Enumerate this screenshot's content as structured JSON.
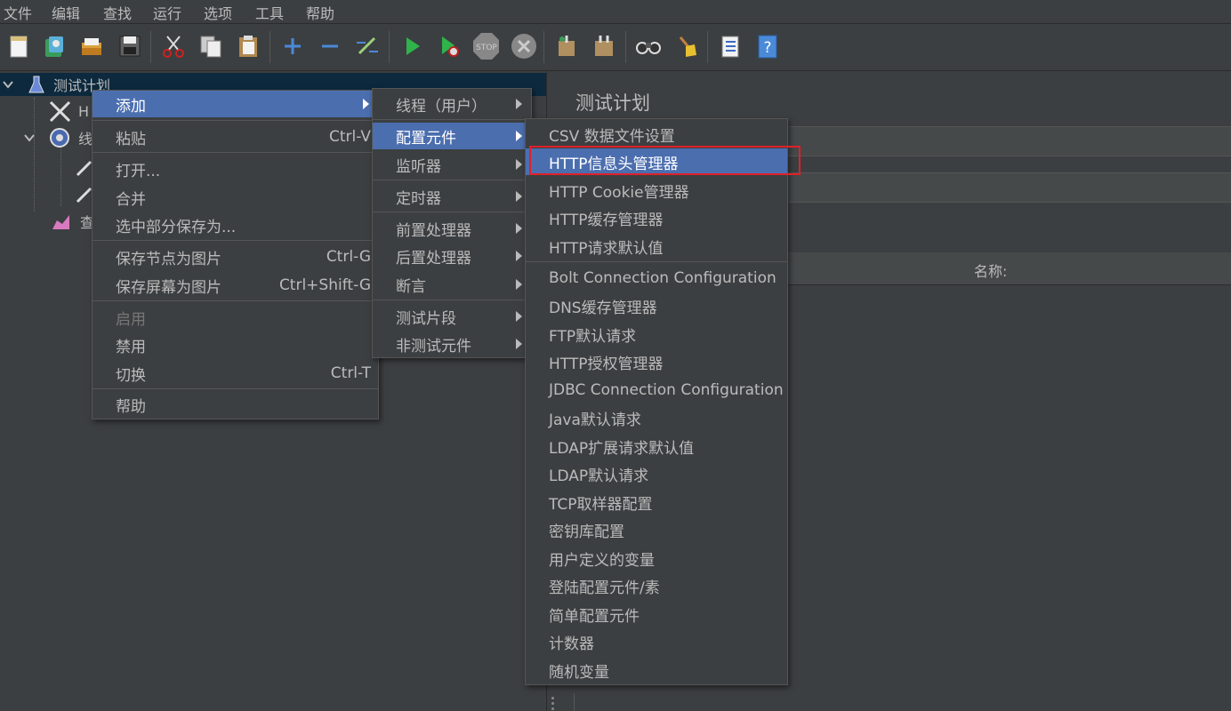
{
  "menubar": [
    "文件",
    "编辑",
    "查找",
    "运行",
    "选项",
    "工具",
    "帮助"
  ],
  "toolbar": {
    "icons": [
      "new-icon",
      "templates-icon",
      "open-icon",
      "save-icon",
      "cut-icon",
      "copy-icon",
      "paste-icon",
      "expand-icon",
      "collapse-icon",
      "toggle-icon",
      "start-icon",
      "start-no-pause-icon",
      "stop-icon",
      "shutdown-icon",
      "clear-icon",
      "clear-all-icon",
      "search-icon",
      "reset-search-icon",
      "function-helper-icon",
      "help-icon"
    ],
    "stop_text": "STOP"
  },
  "tree": {
    "root": "测试计划",
    "child1": "H",
    "child2": "线",
    "child3": "查"
  },
  "right_panel": {
    "title": "测试计划",
    "name_column": "名称:"
  },
  "context_menu": {
    "items": [
      {
        "label": "添加",
        "shortcut": "",
        "submenu": true,
        "active": true
      },
      {
        "label": "粘贴",
        "shortcut": "Ctrl-V"
      },
      {
        "label": "打开...",
        "shortcut": ""
      },
      {
        "label": "合并",
        "shortcut": ""
      },
      {
        "label": "选中部分保存为...",
        "shortcut": ""
      },
      {
        "label": "保存节点为图片",
        "shortcut": "Ctrl-G"
      },
      {
        "label": "保存屏幕为图片",
        "shortcut": "Ctrl+Shift-G"
      },
      {
        "label": "启用",
        "shortcut": "",
        "disabled": true
      },
      {
        "label": "禁用",
        "shortcut": ""
      },
      {
        "label": "切换",
        "shortcut": "Ctrl-T"
      },
      {
        "label": "帮助",
        "shortcut": ""
      }
    ]
  },
  "add_submenu": {
    "items": [
      "线程（用户）",
      "配置元件",
      "监听器",
      "定时器",
      "前置处理器",
      "后置处理器",
      "断言",
      "测试片段",
      "非测试元件"
    ],
    "active_index": 1
  },
  "config_submenu": {
    "items": [
      "CSV 数据文件设置",
      "HTTP信息头管理器",
      "HTTP Cookie管理器",
      "HTTP缓存管理器",
      "HTTP请求默认值",
      "Bolt Connection Configuration",
      "DNS缓存管理器",
      "FTP默认请求",
      "HTTP授权管理器",
      "JDBC Connection Configuration",
      "Java默认请求",
      "LDAP扩展请求默认值",
      "LDAP默认请求",
      "TCP取样器配置",
      "密钥库配置",
      "用户定义的变量",
      "登陆配置元件/素",
      "简单配置元件",
      "计数器",
      "随机变量"
    ],
    "active_index": 1
  },
  "colors": {
    "background": "#3c3f41",
    "selection": "#4b6eaf",
    "highlight_box": "#e0202a"
  }
}
